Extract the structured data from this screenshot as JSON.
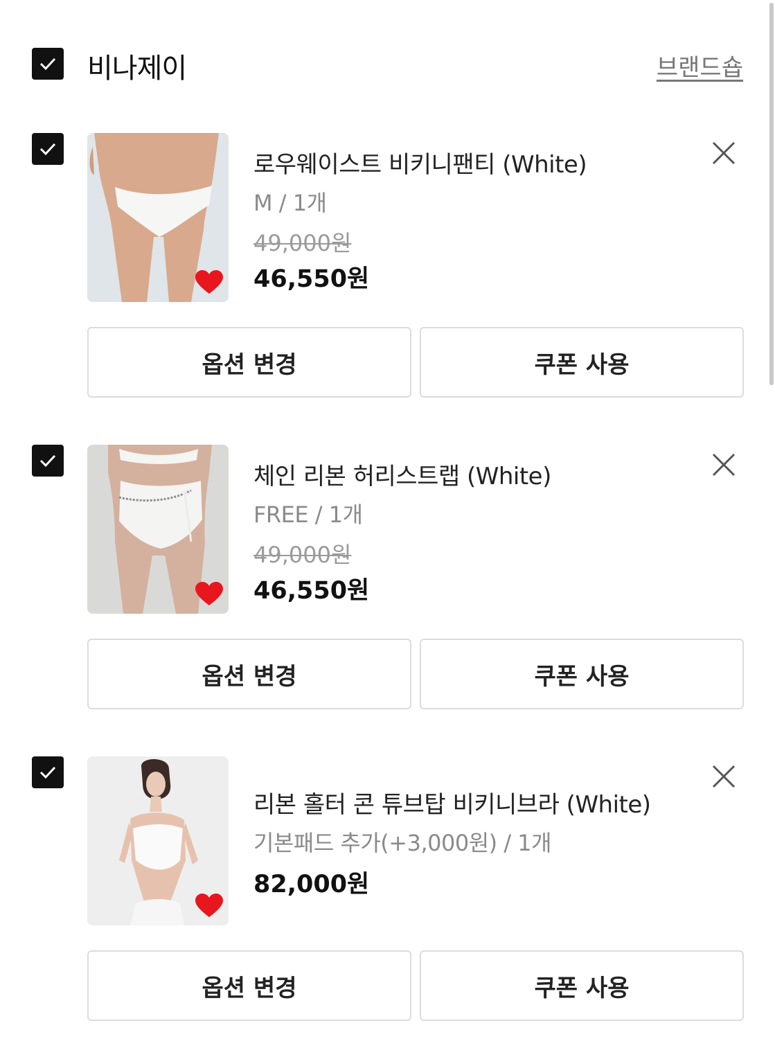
{
  "brand": {
    "name": "비나제이",
    "shop_link": "브랜드숍",
    "checked": true
  },
  "items": [
    {
      "checked": true,
      "title": "로우웨이스트 비키니팬티 (White)",
      "option": "M / 1개",
      "original_price": "49,000원",
      "price": "46,550원",
      "option_button": "옵션 변경",
      "coupon_button": "쿠폰 사용"
    },
    {
      "checked": true,
      "title": "체인 리본 허리스트랩 (White)",
      "option": "FREE / 1개",
      "original_price": "49,000원",
      "price": "46,550원",
      "option_button": "옵션 변경",
      "coupon_button": "쿠폰 사용"
    },
    {
      "checked": true,
      "title": "리본 홀터 콘 튜브탑 비키니브라 (White)",
      "option": "기본패드 추가(+3,000원) / 1개",
      "original_price": "",
      "price": "82,000원",
      "option_button": "옵션 변경",
      "coupon_button": "쿠폰 사용"
    }
  ],
  "colors": {
    "checkbox": "#111111",
    "heart": "#e8161d",
    "button_border": "#dcdcdc",
    "muted_text": "#8a8a8a"
  }
}
